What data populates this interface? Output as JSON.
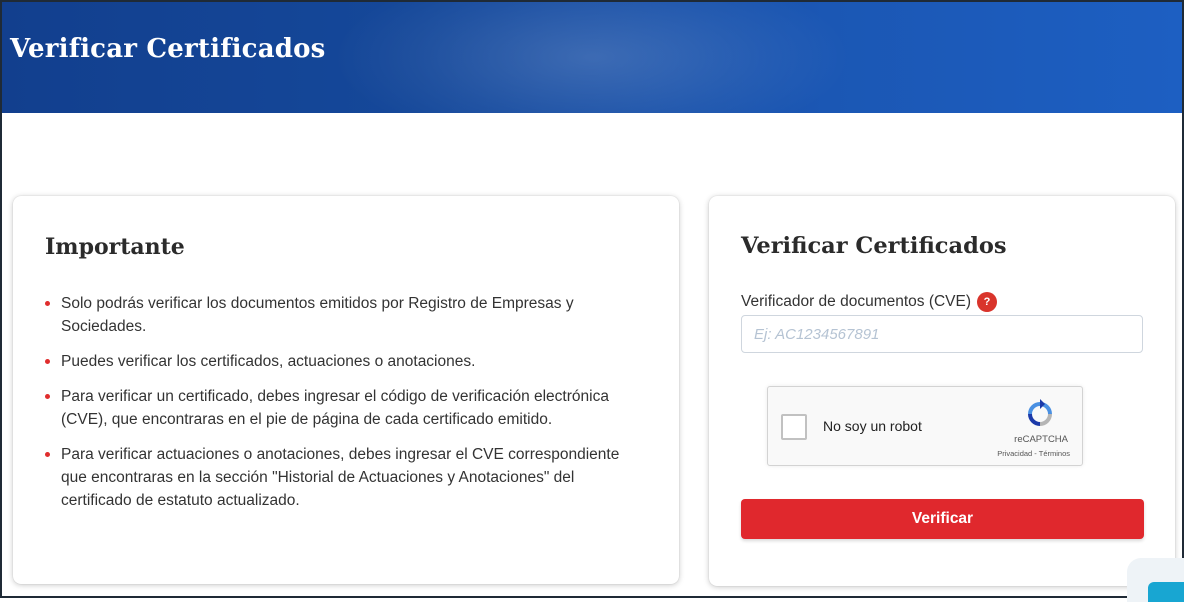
{
  "header": {
    "title": "Verificar Certificados"
  },
  "info_card": {
    "title": "Importante",
    "bullets": [
      "Solo podrás verificar los documentos emitidos por Registro de Empresas y Sociedades.",
      "Puedes verificar los certificados, actuaciones o anotaciones.",
      "Para verificar un certificado, debes ingresar el código de verificación electrónica (CVE), que encontraras en el pie de página de cada certificado emitido.",
      "Para verificar actuaciones o anotaciones, debes ingresar el CVE correspondiente que encontraras en la sección \"Historial de Actuaciones y Anotaciones\" del certificado de estatuto actualizado."
    ]
  },
  "form_card": {
    "title": "Verificar Certificados",
    "field_label": "Verificador de documentos (CVE)",
    "help_icon": "?",
    "input_value": "",
    "input_placeholder": "Ej: AC1234567891",
    "recaptcha": {
      "label": "No soy un robot",
      "brand": "reCAPTCHA",
      "links": "Privacidad - Términos"
    },
    "submit_label": "Verificar"
  },
  "colors": {
    "banner": "#15489a",
    "accent_red": "#e0282d",
    "bullet_red": "#e02d2d",
    "placeholder": "#b5c3d3",
    "widget_blue": "#18a6d2"
  }
}
